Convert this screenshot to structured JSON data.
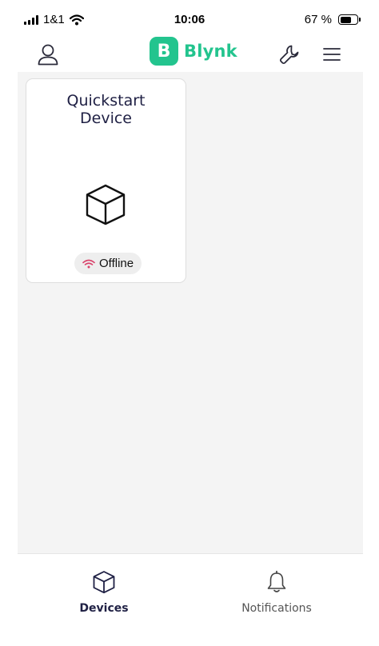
{
  "status_bar": {
    "carrier": "1&1",
    "time": "10:06",
    "battery_text": "67 %",
    "battery_level": 0.67
  },
  "header": {
    "logo_letter": "B",
    "brand_name": "Blynk",
    "icons": {
      "profile": "user-icon",
      "settings": "wrench-icon",
      "menu": "hamburger-menu-icon"
    }
  },
  "devices": [
    {
      "name": "Quickstart Device",
      "icon": "cube-icon",
      "status": "Offline",
      "status_icon": "wifi-icon",
      "status_icon_color": "#d9436b"
    }
  ],
  "bottom_nav": {
    "items": [
      {
        "label": "Devices",
        "icon": "cube-icon",
        "active": true
      },
      {
        "label": "Notifications",
        "icon": "bell-icon",
        "active": false
      }
    ]
  },
  "colors": {
    "brand": "#23c48e",
    "title_text": "#1f2044",
    "content_background": "#f4f4f4"
  }
}
